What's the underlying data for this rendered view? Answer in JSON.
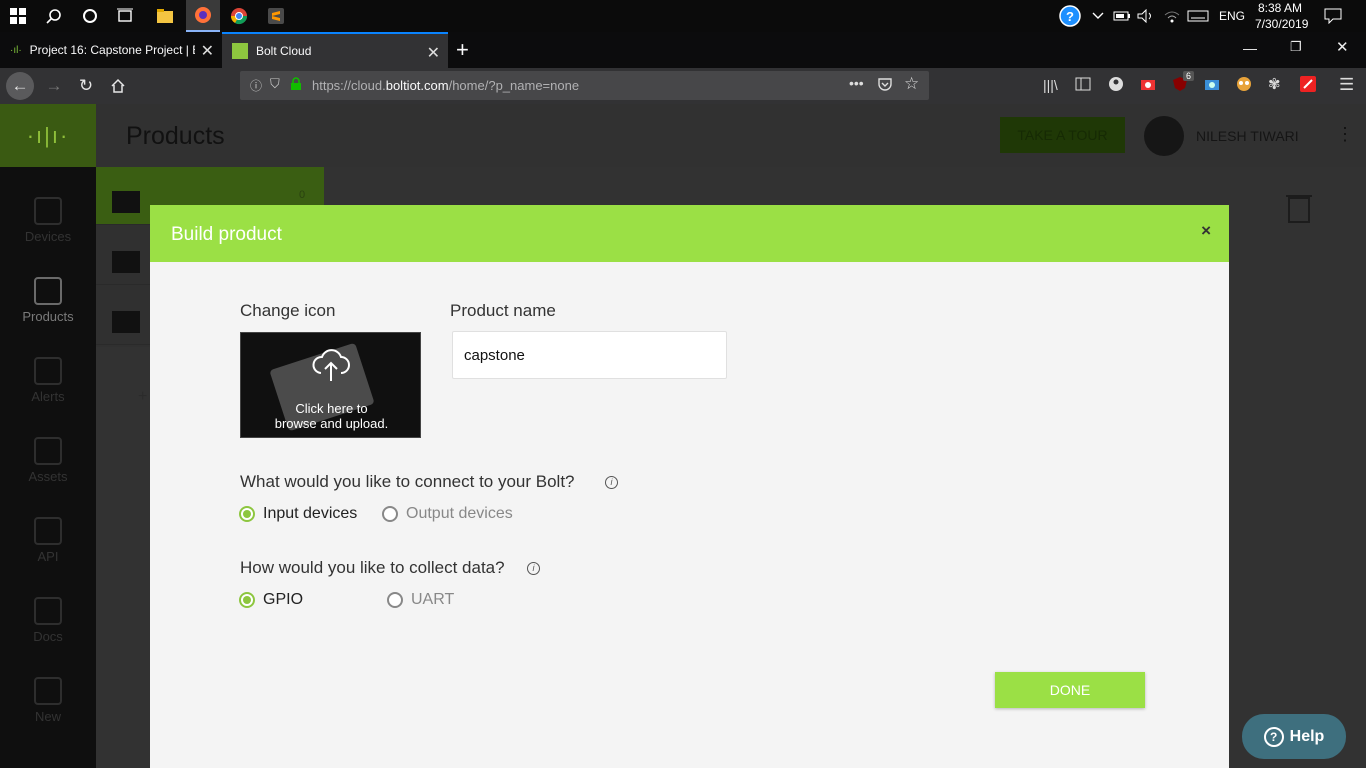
{
  "taskbar": {
    "time": "8:38 AM",
    "date": "7/30/2019",
    "lang": "ENG"
  },
  "browser": {
    "tabs": [
      {
        "label": "Project 16: Capstone Project | B"
      },
      {
        "label": "Bolt Cloud"
      }
    ],
    "url_prefix": "https://cloud.",
    "url_domain": "boltiot.com",
    "url_suffix": "/home/?p_name=none",
    "badge_count": "6"
  },
  "app": {
    "page_title": "Products",
    "tour_button": "TAKE A TOUR",
    "user_name": "NILESH TIWARI",
    "sidebar": [
      {
        "label": "Devices"
      },
      {
        "label": "Products"
      },
      {
        "label": "Alerts"
      },
      {
        "label": "Assets"
      },
      {
        "label": "API"
      },
      {
        "label": "Docs"
      },
      {
        "label": "New"
      }
    ],
    "list_count": "0"
  },
  "modal": {
    "title": "Build product",
    "close": "×",
    "change_icon_label": "Change icon",
    "upload_text_line1": "Click here to",
    "upload_text_line2": "browse and upload.",
    "product_name_label": "Product name",
    "product_name_value": "capstone",
    "connect_question": "What would you like to connect to your Bolt?",
    "connect_options": [
      {
        "label": "Input devices",
        "selected": true
      },
      {
        "label": "Output devices",
        "selected": false
      }
    ],
    "collect_question": "How would you like to collect data?",
    "collect_options": [
      {
        "label": "GPIO",
        "selected": true
      },
      {
        "label": "UART",
        "selected": false
      }
    ],
    "done_button": "DONE"
  },
  "help_button": "Help",
  "colors": {
    "accent": "#9be045",
    "radio_selected": "#8dc63f",
    "help": "#3e6f7e"
  }
}
